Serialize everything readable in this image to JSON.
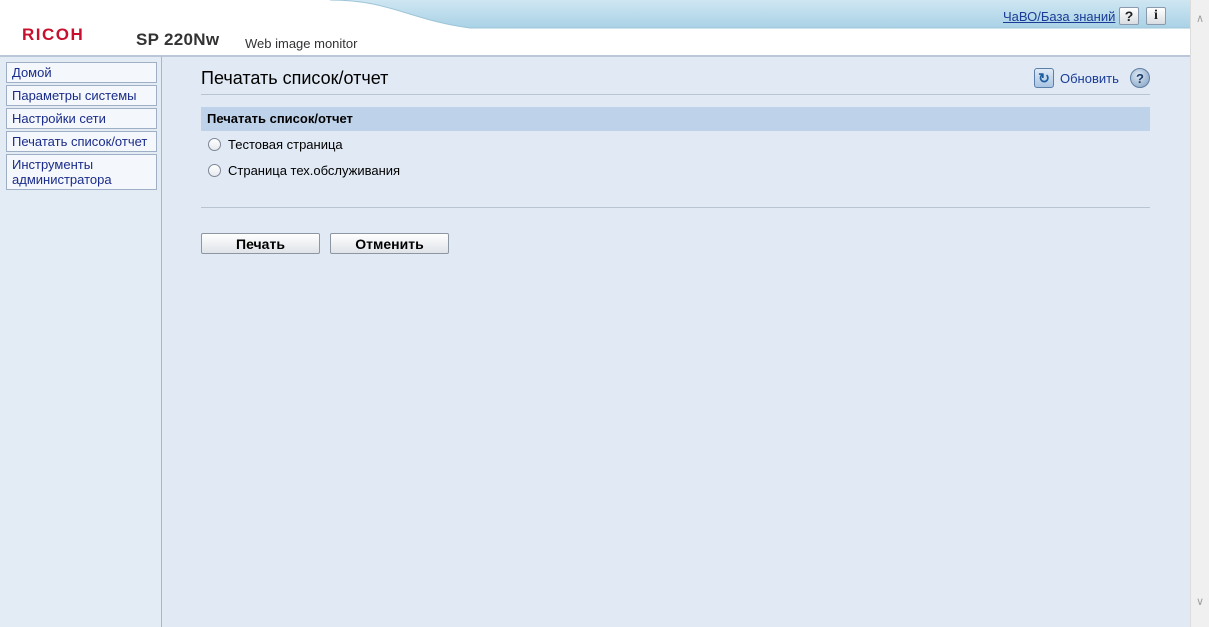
{
  "header": {
    "logo": "RICOH",
    "model": "SP 220Nw",
    "app_name": "Web image monitor",
    "faq_link": "ЧаВО/База знаний",
    "help_glyph": "?",
    "info_glyph": "i"
  },
  "sidebar": {
    "items": [
      {
        "label": "Домой"
      },
      {
        "label": "Параметры системы"
      },
      {
        "label": "Настройки сети"
      },
      {
        "label": "Печатать список/отчет"
      },
      {
        "label": "Инструменты администратора"
      }
    ]
  },
  "main": {
    "page_title": "Печатать список/отчет",
    "refresh_label": "Обновить",
    "help_glyph": "?",
    "section_title": "Печатать список/отчет",
    "options": [
      {
        "label": "Тестовая страница",
        "selected": false
      },
      {
        "label": "Страница тех.обслуживания",
        "selected": false
      }
    ],
    "buttons": {
      "print": "Печать",
      "cancel": "Отменить"
    }
  },
  "icons": {
    "refresh": "refresh-icon",
    "help": "help-icon",
    "info": "info-icon"
  },
  "colors": {
    "brand": "#c8102e",
    "link": "#1a3c96",
    "section_bar": "#bed3ea",
    "main_bg": "#e0e9f4"
  }
}
